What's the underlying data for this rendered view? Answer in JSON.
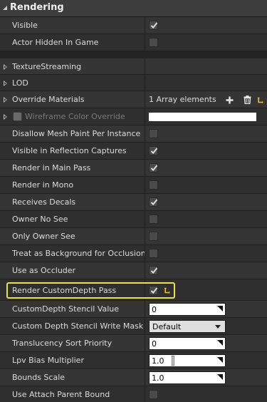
{
  "header": {
    "title": "Rendering"
  },
  "properties": {
    "visible": {
      "label": "Visible",
      "checked": true
    },
    "actor_hidden": {
      "label": "Actor Hidden In Game",
      "checked": false
    },
    "texture_streaming": {
      "label": "TextureStreaming"
    },
    "lod": {
      "label": "LOD"
    },
    "override_materials": {
      "label": "Override Materials",
      "value": "1 Array elements"
    },
    "wireframe_color": {
      "label": "Wireframe Color Override",
      "checked": false,
      "color": "#ffffff"
    },
    "disallow_mesh_paint": {
      "label": "Disallow Mesh Paint Per Instance",
      "checked": false
    },
    "visible_reflection": {
      "label": "Visible in Reflection Captures",
      "checked": true
    },
    "render_main_pass": {
      "label": "Render in Main Pass",
      "checked": true
    },
    "render_mono": {
      "label": "Render in Mono",
      "checked": false
    },
    "receives_decals": {
      "label": "Receives Decals",
      "checked": true
    },
    "owner_no_see": {
      "label": "Owner No See",
      "checked": false
    },
    "only_owner_see": {
      "label": "Only Owner See",
      "checked": false
    },
    "background_occlusion": {
      "label": "Treat as Background for Occlusion",
      "checked": false
    },
    "use_as_occluder": {
      "label": "Use as Occluder",
      "checked": true
    },
    "render_custom_depth": {
      "label": "Render CustomDepth Pass",
      "checked": true
    },
    "custom_depth_stencil": {
      "label": "CustomDepth Stencil Value",
      "value": "0"
    },
    "stencil_write_mask": {
      "label": "Custom Depth Stencil Write Mask",
      "value": "Default"
    },
    "translucency_priority": {
      "label": "Translucency Sort Priority",
      "value": "0"
    },
    "lpv_bias": {
      "label": "Lpv Bias Multiplier",
      "value": "1.0"
    },
    "bounds_scale": {
      "label": "Bounds Scale",
      "value": "1.0"
    },
    "attach_parent_bound": {
      "label": "Use Attach Parent Bound",
      "checked": false
    }
  },
  "colors": {
    "highlight": "#e8e055",
    "reset_arrow": "#e8c22a",
    "panel": "#353535"
  }
}
